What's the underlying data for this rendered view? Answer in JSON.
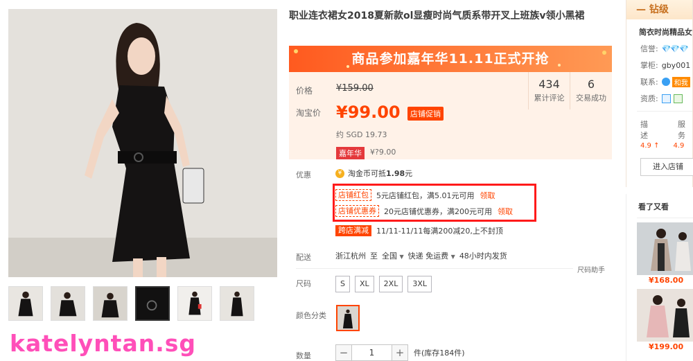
{
  "product": {
    "title": "职业连衣裙女2018夏新款ol显瘦时尚气质系带开叉上班族v领小黑裙"
  },
  "banner": {
    "text": "商品参加嘉年华11.11正式开抢"
  },
  "price": {
    "label": "价格",
    "old": "¥159.00",
    "taobao_label": "淘宝价",
    "current": "¥99.00",
    "shop_promo": "店铺促销",
    "sgd": "约 SGD 19.73",
    "carnival_tag": "嘉年华",
    "carnival_price": "¥?9.00"
  },
  "stats": [
    {
      "num": "434",
      "cap": "累计评论"
    },
    {
      "num": "6",
      "cap": "交易成功"
    }
  ],
  "offers": {
    "label": "优惠",
    "coin_icon": "¥",
    "coin_text": "淘金币可抵",
    "coin_amount": "1.98",
    "coin_unit": "元",
    "coupons": [
      {
        "tag": "店铺红包",
        "text": "5元店铺红包，满5.01元可用",
        "action": "领取"
      },
      {
        "tag": "店铺优惠券",
        "text": "20元店铺优惠券，满200元可用",
        "action": "领取"
      }
    ],
    "cross_tag": "跨店满减",
    "cross_text": "11/11-11/11每满200减20,上不封顶"
  },
  "delivery": {
    "label": "配送",
    "from": "浙江杭州",
    "to_word": "至",
    "to": "全国",
    "method": "快递 免运费",
    "ship_time": "48小时内发货"
  },
  "size_helper": "尺码助手",
  "sizes": {
    "label": "尺码",
    "options": [
      "S",
      "XL",
      "2XL",
      "3XL"
    ]
  },
  "colors": {
    "label": "颜色分类"
  },
  "quantity": {
    "label": "数量",
    "minus": "−",
    "value": "1",
    "plus": "+",
    "stock": "件(库存184件)"
  },
  "watermark": "katelyntan.sg",
  "shop": {
    "level": "— 钻级",
    "name": "简衣时尚精品女",
    "credit_label": "信誉:",
    "credit": "💎💎💎",
    "keeper_label": "掌柜:",
    "keeper": "gby001",
    "contact_label": "联系:",
    "contact_badge": "和我",
    "qual_label": "资质:",
    "desc_label": "描述",
    "desc_score": "4.9 ↑",
    "service_label": "服务",
    "service_score": "4.9",
    "enter": "进入店铺"
  },
  "also": {
    "title": "看了又看",
    "items": [
      {
        "price": "¥168.00"
      },
      {
        "price": "¥199.00"
      }
    ]
  },
  "colors_palette": {
    "accent": "#ff4400",
    "banner": "#ff5a1f",
    "price_bg": "#fff2e8",
    "highlight_box": "#ff1a1a",
    "watermark": "#ff4fb9"
  }
}
